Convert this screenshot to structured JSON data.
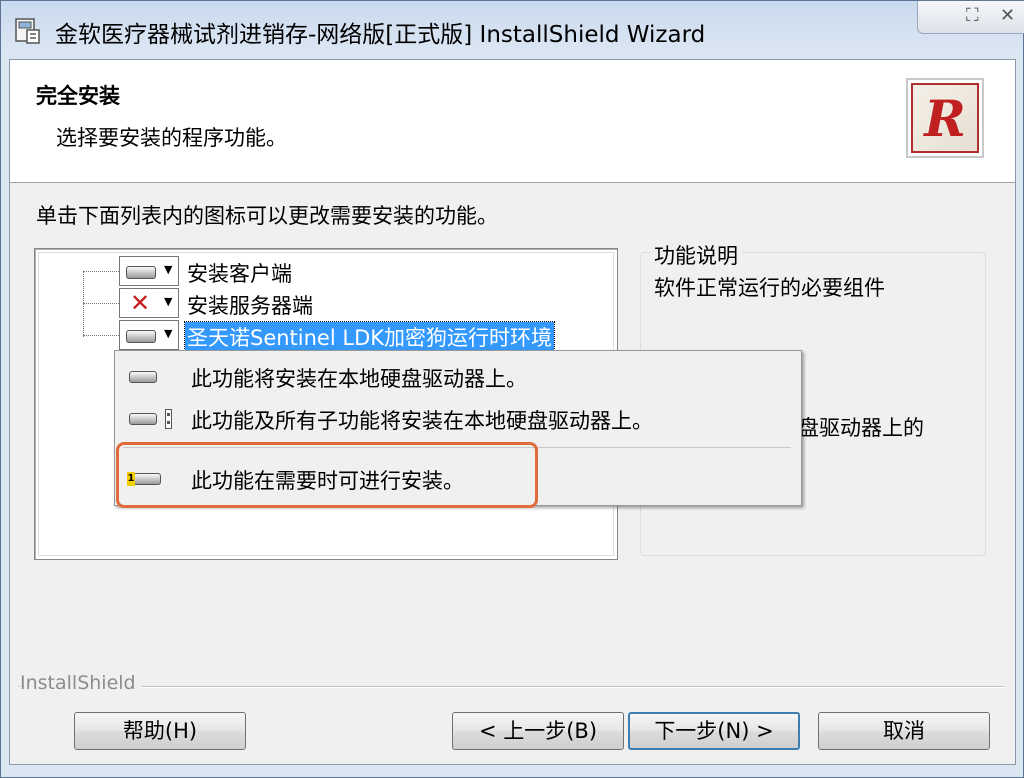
{
  "window": {
    "title": "金软医疗器械试剂进销存-网络版[正式版] InstallShield Wizard",
    "controls": {
      "restore": "⛶",
      "close": "✕"
    }
  },
  "header": {
    "title": "完全安装",
    "subtitle": "选择要安装的程序功能。",
    "logo_letter": "R"
  },
  "instruction": "单击下面列表内的图标可以更改需要安装的功能。",
  "features": [
    {
      "label": "安装客户端",
      "state": "install-local",
      "icon": "hard-disk-icon"
    },
    {
      "label": "安装服务器端",
      "state": "not-available",
      "icon": "red-x-icon"
    },
    {
      "label": "圣天诺Sentinel LDK加密狗运行时环境",
      "state": "install-local",
      "icon": "hard-disk-icon",
      "selected": true
    }
  ],
  "description": {
    "legend": "功能说明",
    "text": "软件正常运行的必要组件",
    "partial_text": "盘驱动器上的"
  },
  "popup_menu": {
    "items": [
      {
        "label": "此功能将安装在本地硬盘驱动器上。",
        "icon": "hard-disk-icon"
      },
      {
        "label": "此功能及所有子功能将安装在本地硬盘驱动器上。",
        "icon": "hard-disk-tree-icon"
      },
      {
        "label": "此功能在需要时可进行安装。",
        "icon": "install-on-demand-icon",
        "highlighted": true
      }
    ]
  },
  "footer": {
    "brand": "InstallShield",
    "help": "帮助(H)",
    "back": "< 上一步(B)",
    "next": "下一步(N) >",
    "cancel": "取消"
  },
  "colors": {
    "selection": "#3399ff",
    "highlight_box": "#e06c3c",
    "x_mark": "#c81e1e",
    "logo_red": "#c02020"
  }
}
